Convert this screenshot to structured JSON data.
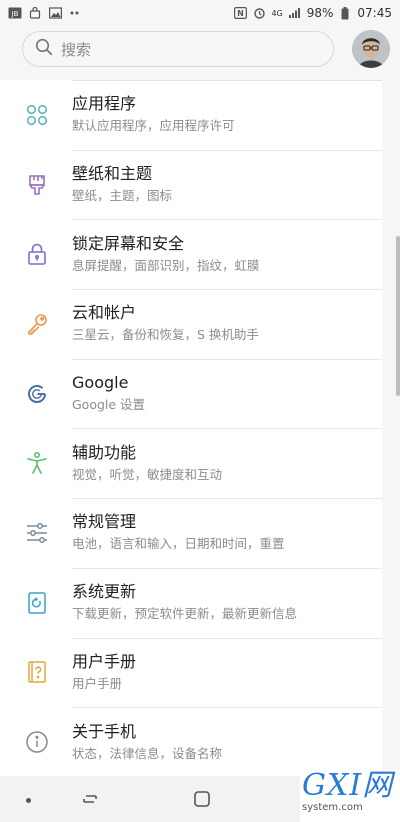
{
  "status_bar": {
    "network": "4G",
    "battery": "98%",
    "time": "07:45"
  },
  "search": {
    "placeholder": "搜索"
  },
  "settings": [
    {
      "title": "应用程序",
      "subtitle": "默认应用程序，应用程序许可",
      "icon": "apps-icon",
      "color": "#5cb8c4"
    },
    {
      "title": "壁纸和主题",
      "subtitle": "壁纸，主题，图标",
      "icon": "brush-icon",
      "color": "#9b6fc1"
    },
    {
      "title": "锁定屏幕和安全",
      "subtitle": "息屏提醒，面部识别，指纹，虹膜",
      "icon": "lock-icon",
      "color": "#7a6fc9"
    },
    {
      "title": "云和帐户",
      "subtitle": "三星云，备份和恢复，S 换机助手",
      "icon": "key-icon",
      "color": "#e69a4b"
    },
    {
      "title": "Google",
      "subtitle": "Google 设置",
      "icon": "google-icon",
      "color": "#4a6fa5"
    },
    {
      "title": "辅助功能",
      "subtitle": "视觉，听觉，敏捷度和互动",
      "icon": "accessibility-icon",
      "color": "#5bbf6a"
    },
    {
      "title": "常规管理",
      "subtitle": "电池，语言和输入，日期和时间，重置",
      "icon": "sliders-icon",
      "color": "#7b8a9c"
    },
    {
      "title": "系统更新",
      "subtitle": "下载更新，预定软件更新，最新更新信息",
      "icon": "system-update-icon",
      "color": "#3aa1c9"
    },
    {
      "title": "用户手册",
      "subtitle": "用户手册",
      "icon": "manual-icon",
      "color": "#e0a93a"
    },
    {
      "title": "关于手机",
      "subtitle": "状态，法律信息，设备名称",
      "icon": "info-icon",
      "color": "#8a8a8a"
    }
  ],
  "watermark": {
    "main": "GXI网",
    "sub": "system.com"
  }
}
